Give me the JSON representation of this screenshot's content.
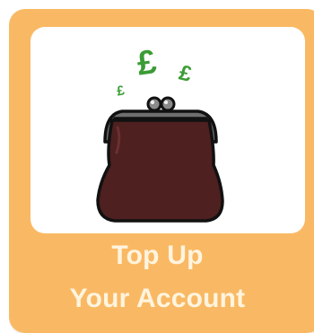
{
  "card": {
    "title_line1": "Top Up",
    "title_line2": "Your Account",
    "background_color": "#f9b964",
    "title_color": "#fff4df"
  },
  "illustration": {
    "subject": "purse-with-pound-coins",
    "pound_symbol_large": "£",
    "pound_symbol_medium": "£",
    "pound_symbol_small": "£",
    "symbol_color": "#3b9c35",
    "purse_color": "#4e2020",
    "clasp_color": "#6e6e6e"
  }
}
